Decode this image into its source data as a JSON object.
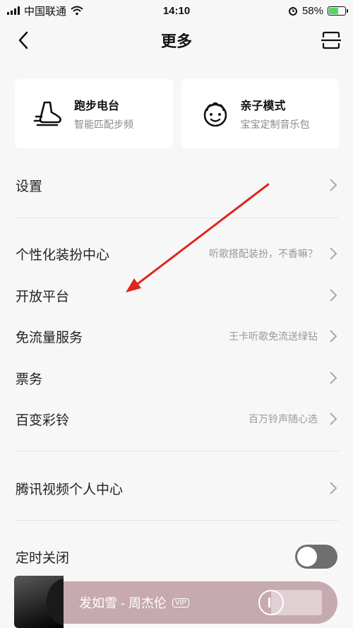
{
  "status_bar": {
    "carrier": "中国联通",
    "time": "14:10",
    "battery": "58%"
  },
  "header": {
    "title": "更多"
  },
  "cards": [
    {
      "title": "跑步电台",
      "subtitle": "智能匹配步频",
      "icon": "running-shoe-icon"
    },
    {
      "title": "亲子模式",
      "subtitle": "宝宝定制音乐包",
      "icon": "child-face-icon"
    }
  ],
  "menu": {
    "settings": {
      "label": "设置"
    },
    "personalize": {
      "label": "个性化装扮中心",
      "hint": "听歌搭配装扮，不香嘛？"
    },
    "open_platform": {
      "label": "开放平台"
    },
    "free_data": {
      "label": "免流量服务",
      "hint": "王卡听歌免流送绿钻"
    },
    "tickets": {
      "label": "票务"
    },
    "ringtone": {
      "label": "百变彩铃",
      "hint": "百万铃声随心选"
    },
    "tencent_video": {
      "label": "腾讯视频个人中心"
    },
    "timer_off": {
      "label": "定时关闭",
      "toggle_on": false
    }
  },
  "player": {
    "song": "发如雪 - 周杰伦",
    "badge": "VIP"
  },
  "colors": {
    "annotation_arrow": "#e0261f",
    "player_bg": "#c6aab0",
    "toggle_off": "#6e6e6e"
  }
}
